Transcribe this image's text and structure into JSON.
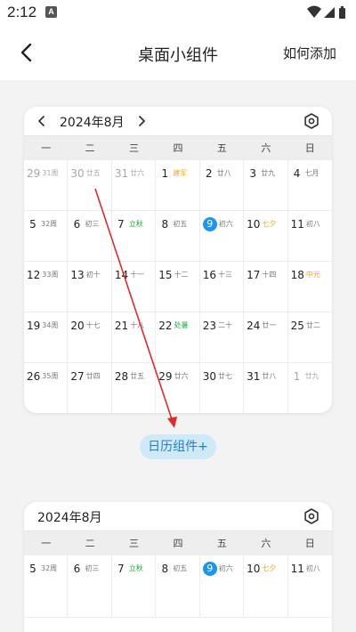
{
  "status_bar": {
    "time": "2:12",
    "notification_badge": "A",
    "icons": [
      "wifi-icon",
      "signal-icon",
      "battery-icon"
    ]
  },
  "app_bar": {
    "title": "桌面小组件",
    "action": "如何添加",
    "back_icon": "chevron-left-icon"
  },
  "weekdays": [
    "一",
    "二",
    "三",
    "四",
    "五",
    "六",
    "日"
  ],
  "calendar1": {
    "month": "2024年8月",
    "days": [
      {
        "n": "29",
        "s": "31周",
        "c": "other"
      },
      {
        "n": "30",
        "s": "廿五",
        "c": "other"
      },
      {
        "n": "31",
        "s": "廿六",
        "c": "other"
      },
      {
        "n": "1",
        "s": "建军",
        "c": "orange"
      },
      {
        "n": "2",
        "s": "廿八",
        "c": ""
      },
      {
        "n": "3",
        "s": "廿九",
        "c": ""
      },
      {
        "n": "4",
        "s": "七月",
        "c": ""
      },
      {
        "n": "5",
        "s": "32周",
        "c": ""
      },
      {
        "n": "6",
        "s": "初三",
        "c": ""
      },
      {
        "n": "7",
        "s": "立秋",
        "c": "green"
      },
      {
        "n": "8",
        "s": "初五",
        "c": ""
      },
      {
        "n": "9",
        "s": "初六",
        "c": "today"
      },
      {
        "n": "10",
        "s": "七夕",
        "c": "orange"
      },
      {
        "n": "11",
        "s": "初八",
        "c": ""
      },
      {
        "n": "12",
        "s": "33周",
        "c": ""
      },
      {
        "n": "13",
        "s": "初十",
        "c": ""
      },
      {
        "n": "14",
        "s": "十一",
        "c": ""
      },
      {
        "n": "15",
        "s": "十二",
        "c": ""
      },
      {
        "n": "16",
        "s": "十三",
        "c": ""
      },
      {
        "n": "17",
        "s": "十四",
        "c": ""
      },
      {
        "n": "18",
        "s": "中元",
        "c": "orange"
      },
      {
        "n": "19",
        "s": "34周",
        "c": ""
      },
      {
        "n": "20",
        "s": "十七",
        "c": ""
      },
      {
        "n": "21",
        "s": "十八",
        "c": ""
      },
      {
        "n": "22",
        "s": "处暑",
        "c": "green"
      },
      {
        "n": "23",
        "s": "二十",
        "c": ""
      },
      {
        "n": "24",
        "s": "廿一",
        "c": ""
      },
      {
        "n": "25",
        "s": "廿二",
        "c": ""
      },
      {
        "n": "26",
        "s": "35周",
        "c": ""
      },
      {
        "n": "27",
        "s": "廿四",
        "c": ""
      },
      {
        "n": "28",
        "s": "廿五",
        "c": ""
      },
      {
        "n": "29",
        "s": "廿六",
        "c": ""
      },
      {
        "n": "30",
        "s": "廿七",
        "c": ""
      },
      {
        "n": "31",
        "s": "廿八",
        "c": ""
      },
      {
        "n": "1",
        "s": "廿九",
        "c": "other"
      }
    ]
  },
  "widget_button": "日历组件+",
  "calendar2": {
    "month": "2024年8月",
    "days": [
      {
        "n": "5",
        "s": "32周",
        "c": ""
      },
      {
        "n": "6",
        "s": "初三",
        "c": ""
      },
      {
        "n": "7",
        "s": "立秋",
        "c": "green"
      },
      {
        "n": "8",
        "s": "初五",
        "c": ""
      },
      {
        "n": "9",
        "s": "初六",
        "c": "today"
      },
      {
        "n": "10",
        "s": "七夕",
        "c": "orange"
      },
      {
        "n": "11",
        "s": "初八",
        "c": ""
      }
    ]
  },
  "colors": {
    "accent": "#1f95e8",
    "green": "#1aaa3c",
    "orange": "#f5a623",
    "arrow": "#e02b2b",
    "pill_bg": "#cfe9f9"
  }
}
